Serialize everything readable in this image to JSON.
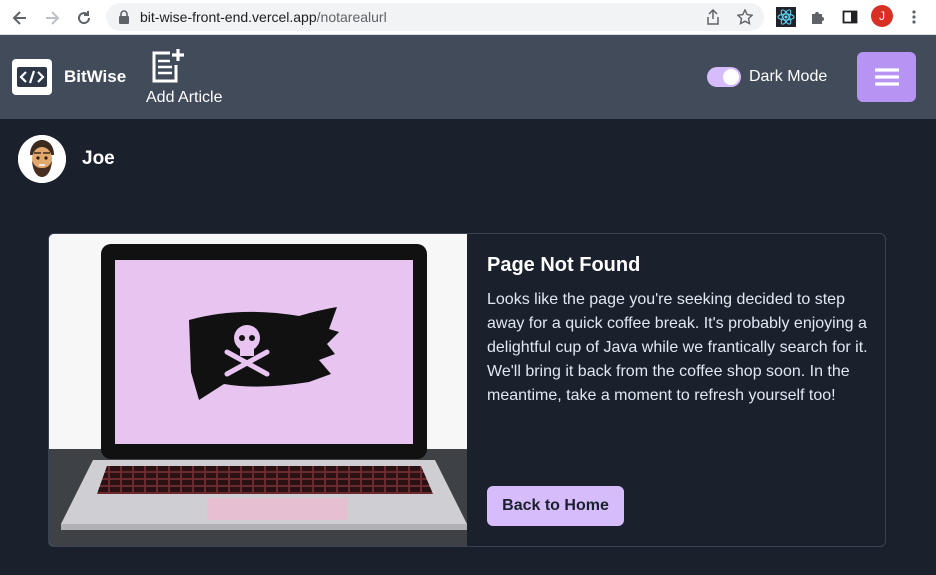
{
  "browser": {
    "url_host": "bit-wise-front-end.vercel.app",
    "url_path": "/notarealurl",
    "profile_initial": "J"
  },
  "header": {
    "brand": "BitWise",
    "add_article_label": "Add Article",
    "dark_mode_label": "Dark Mode",
    "dark_mode_on": true
  },
  "user": {
    "name": "Joe"
  },
  "card": {
    "title": "Page Not Found",
    "body": "Looks like the page you're seeking decided to step away for a quick coffee break. It's probably enjoying a delightful cup of Java while we frantically search for it. We'll bring it back from the coffee shop soon. In the meantime, take a moment to refresh yourself too!",
    "button_label": "Back to Home"
  },
  "colors": {
    "page_bg": "#1a202c",
    "header_bg": "#414b5a",
    "accent": "#b794f4",
    "accent_light": "#d6bcfa"
  },
  "icons": {
    "back": "arrow-left-icon",
    "forward": "arrow-right-icon",
    "reload": "reload-icon",
    "lock": "lock-icon",
    "share": "share-icon",
    "bookmark": "star-icon",
    "react_ext": "react-icon",
    "extensions": "puzzle-icon",
    "sidepanel": "sidepanel-icon",
    "more": "more-vert-icon",
    "logo": "code-icon",
    "add_article": "add-note-icon",
    "menu": "hamburger-icon"
  }
}
